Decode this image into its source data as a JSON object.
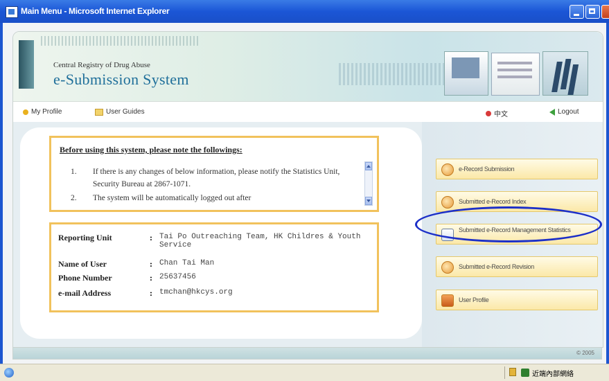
{
  "window": {
    "title": "Main Menu - Microsoft Internet Explorer"
  },
  "header": {
    "registry_name": "Central Registry of Drug Abuse",
    "system_title": "e-Submission System"
  },
  "nav": {
    "my_profile": "My Profile",
    "user_guides": "User Guides",
    "chinese": "中文",
    "logout": "Logout"
  },
  "notice": {
    "title": "Before using this system, please note the followings:",
    "items": [
      {
        "num": "1.",
        "text": "If there is any changes of below information, please notify the Statistics Unit, Security Bureau at 2867-1071."
      },
      {
        "num": "2.",
        "text": "The system will be automatically logged out after"
      }
    ]
  },
  "user_info": {
    "reporting_unit_label": "Reporting Unit",
    "reporting_unit_value": "Tai Po Outreaching Team, HK Childres & Youth Service",
    "name_label": "Name of User",
    "name_value": "Chan Tai Man",
    "phone_label": "Phone Number",
    "phone_value": "25637456",
    "email_label": "e-mail Address",
    "email_value": "tmchan@hkcys.org"
  },
  "menu": [
    {
      "label": "e-Record Submission",
      "icon": "submission-icon"
    },
    {
      "label": "Submitted e-Record Index",
      "icon": "index-icon"
    },
    {
      "label": "Submitted e-Record Management Statistics",
      "icon": "statistics-icon"
    },
    {
      "label": "Submitted e-Record Revision",
      "icon": "revision-icon"
    },
    {
      "label": "User Profile",
      "icon": "user-profile-icon"
    }
  ],
  "footer": {
    "copyright": "© 2005"
  },
  "statusbar": {
    "zone": "近端內部網絡"
  },
  "colors": {
    "accent_border": "#f1c25c",
    "title_blue": "#1f6f9a",
    "highlight_oval": "#1c2fc8"
  }
}
